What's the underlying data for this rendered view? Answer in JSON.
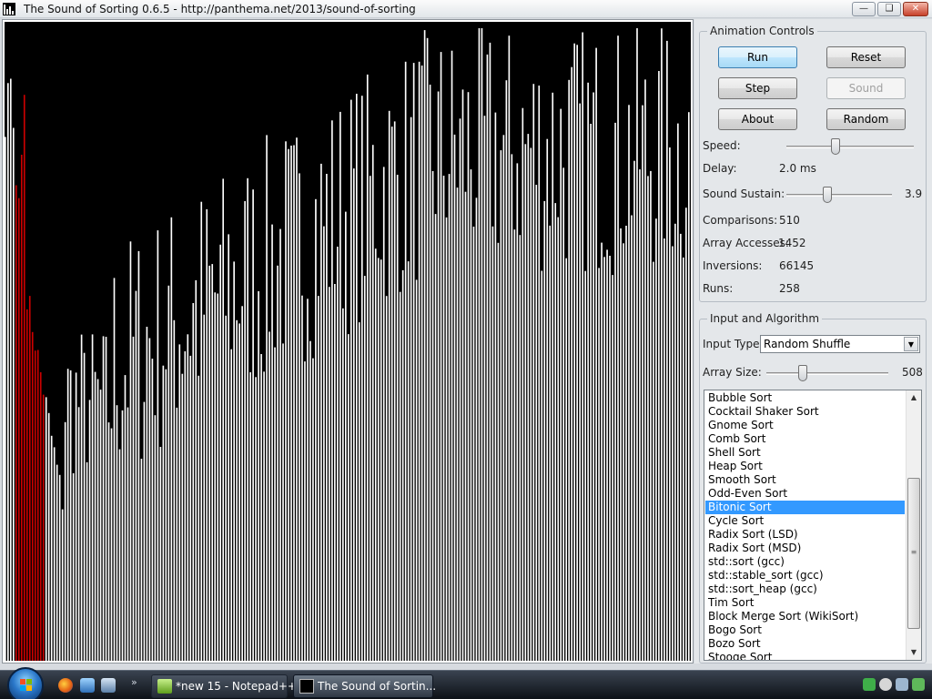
{
  "window": {
    "title": "The Sound of Sorting 0.6.5 - http://panthema.net/2013/sound-of-sorting",
    "minimize_icon": "minimize-icon",
    "maximize_icon": "maximize-icon",
    "close_icon": "close-icon"
  },
  "visualization": {
    "background_color": "#000000",
    "bar_color": "#ffffff",
    "highlight_color": "#cc0000"
  },
  "animation_controls": {
    "title": "Animation Controls",
    "buttons": {
      "run": "Run",
      "reset": "Reset",
      "step": "Step",
      "sound": "Sound",
      "about": "About",
      "random": "Random"
    },
    "speed_label": "Speed:",
    "speed_level": 0.38,
    "delay_label": "Delay:",
    "delay_value": "2.0 ms",
    "sustain_label": "Sound Sustain:",
    "sustain_value": "3.9",
    "sustain_level": 0.38,
    "stats": {
      "comparisons_label": "Comparisons:",
      "comparisons_value": "510",
      "accesses_label": "Array Accesses:",
      "accesses_value": "1452",
      "inversions_label": "Inversions:",
      "inversions_value": "66145",
      "runs_label": "Runs:",
      "runs_value": "258"
    }
  },
  "input_algorithm": {
    "title": "Input and Algorithm",
    "input_type_label": "Input Type:",
    "input_type_value": "Random Shuffle",
    "array_size_label": "Array Size:",
    "array_size_value": "508",
    "array_size_level": 0.28,
    "algorithms": [
      "Bubble Sort",
      "Cocktail Shaker Sort",
      "Gnome Sort",
      "Comb Sort",
      "Shell Sort",
      "Heap Sort",
      "Smooth Sort",
      "Odd-Even Sort",
      "Bitonic Sort",
      "Cycle Sort",
      "Radix Sort (LSD)",
      "Radix Sort (MSD)",
      "std::sort (gcc)",
      "std::stable_sort (gcc)",
      "std::sort_heap (gcc)",
      "Tim Sort",
      "Block Merge Sort (WikiSort)",
      "Bogo Sort",
      "Bozo Sort",
      "Stooge Sort"
    ],
    "selected_index": 8
  },
  "taskbar": {
    "tasks": [
      {
        "label": "*new 15 - Notepad++",
        "icon": "notepad-icon"
      },
      {
        "label": "The Sound of Sortin...",
        "icon": "sorting-app-icon"
      }
    ]
  }
}
